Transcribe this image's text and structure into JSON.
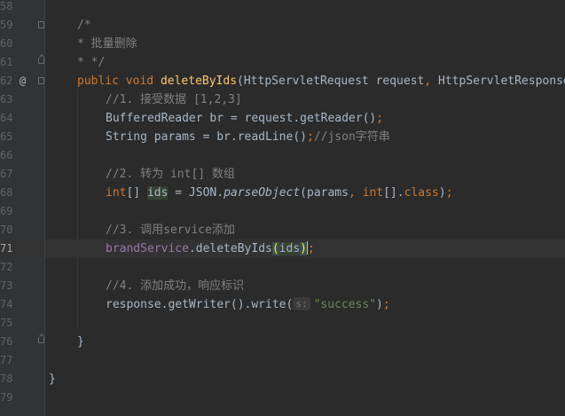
{
  "gutter": {
    "line_numbers": [
      "58",
      "59",
      "60",
      "61",
      "62",
      "63",
      "64",
      "65",
      "66",
      "67",
      "68",
      "69",
      "70",
      "71",
      "72",
      "73",
      "74",
      "75",
      "76",
      "77",
      "78",
      "79"
    ],
    "annotation_marker": "@"
  },
  "code": {
    "l59_text": "/*",
    "l60_text": "* 批量删除",
    "l61_text": "* */",
    "l62_public": "public",
    "l62_void": "void",
    "l62_method": "deleteByIds",
    "l62_params_a": "(HttpServletRequest request",
    "l62_comma": ",",
    "l62_params_b": " HttpServletResponse response)",
    "l63_comment": "//1. 接受数据 [1,2,3]",
    "l64_a": "BufferedReader br = request.getReader()",
    "l64_semi": ";",
    "l65_a": "String params = br.readLine()",
    "l65_semi": ";",
    "l65_comment": "//json字符串",
    "l67_comment": "//2. 转为 int[] 数组",
    "l68_int": "int",
    "l68_b": "[] ",
    "l68_ids": "ids",
    "l68_c": " = JSON.",
    "l68_parse": "parseObject",
    "l68_d": "(params",
    "l68_comma": ",",
    "l68_e": " ",
    "l68_int2": "int",
    "l68_f": "[].",
    "l68_class": "class",
    "l68_g": ")",
    "l68_semi": ";",
    "l70_comment": "//3. 调用service添加",
    "l71_field": "brandService",
    "l71_a": ".deleteByIds",
    "l71_open": "(",
    "l71_ids": "ids",
    "l71_close": ")",
    "l71_semi": ";",
    "l73_comment": "//4. 添加成功，响应标识",
    "l74_a": "response.getWriter().write(",
    "l74_hint": "s:",
    "l74_str": "\"success\"",
    "l74_b": ")",
    "l74_semi": ";",
    "l76_brace": "}",
    "l78_brace": "}"
  }
}
